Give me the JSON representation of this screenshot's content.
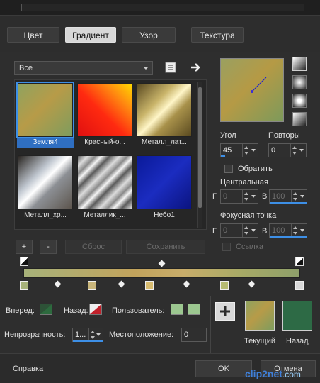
{
  "tabs": [
    {
      "label": "Цвет"
    },
    {
      "label": "Градиент"
    },
    {
      "label": "Узор"
    },
    {
      "label": "Текстура"
    }
  ],
  "category_select": {
    "value": "Все"
  },
  "gradients": [
    {
      "label": "Земля4",
      "selected": true
    },
    {
      "label": "Красный-о..."
    },
    {
      "label": "Металл_лат..."
    },
    {
      "label": "Металл_хр..."
    },
    {
      "label": "Металлик_..."
    },
    {
      "label": "Небо1"
    }
  ],
  "library_buttons": {
    "add": "+",
    "remove": "-",
    "reset": "Сброс",
    "save": "Сохранить"
  },
  "angle": {
    "label": "Угол",
    "value": "45"
  },
  "repeats": {
    "label": "Повторы",
    "value": "0"
  },
  "invert": {
    "label": "Обратить"
  },
  "center": {
    "label": "Центральная",
    "g_label": "Г",
    "v_label": "В",
    "g_value": "0",
    "v_value": "100"
  },
  "focal": {
    "label": "Фокусная точка",
    "g_label": "Г",
    "v_label": "В",
    "g_value": "0",
    "v_value": "100"
  },
  "link": {
    "label": "Ссылка"
  },
  "stops_row": {
    "forward_label": "Вперед:",
    "back_label": "Назад:",
    "user_label": "Пользователь:",
    "opacity_label": "Непрозрачность:",
    "opacity_value": "1...",
    "location_label": "Местоположение:",
    "location_value": "0",
    "add_button": "+"
  },
  "swatches": {
    "current_label": "Текущий",
    "back_label": "Назад"
  },
  "footer": {
    "help": "Справка",
    "ok": "OK",
    "cancel": "Отмена"
  },
  "watermark": {
    "name": "clip2net",
    "tld": ".com"
  },
  "colors": {
    "accent": "#3d8fe6",
    "forward_green": "#2d6a3e",
    "back_red": "#c0202a",
    "user_green": "#9cc790",
    "back_swatch": "#2d6a45"
  },
  "icons": {
    "library": "book-icon",
    "next": "arrow-right-icon",
    "add_stop": "plus-icon"
  }
}
